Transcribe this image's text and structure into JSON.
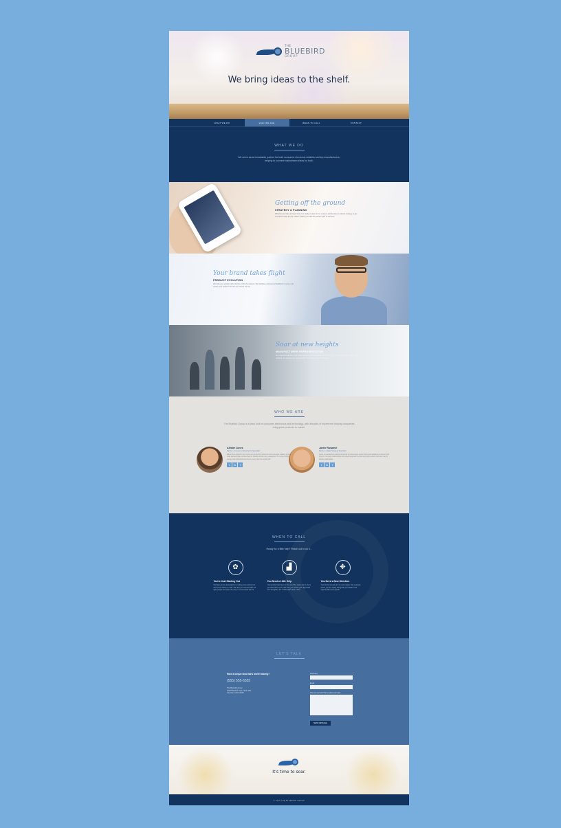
{
  "brand": {
    "the": "THE",
    "name": "BLUEBIRD",
    "group": "GROUP"
  },
  "hero": {
    "headline": "We bring ideas to the shelf."
  },
  "nav": {
    "items": [
      "WHAT WE DO",
      "WHO WE ARE",
      "WHEN TO CALL",
      "CONTACT"
    ],
    "active_index": 1
  },
  "what_we_do": {
    "title": "WHAT WE DO",
    "body": "We serve as an invaluable partner for both consumer electronic retailers and top manufacturers, helping to connect mainstream ideas for both."
  },
  "features": [
    {
      "script": "Getting off the ground",
      "subtitle": "STRATEGY & PLANNING",
      "body": "Whether your idea is brand new or is ready to take off, we analyze and develop a tailored strategy to get a product ready for the market, helping you find the perfect path to success."
    },
    {
      "script": "Your brand takes flight",
      "subtitle": "PRODUCT EVOLUTION",
      "body": "We help your product shine before it hits the shelves. We facilitate professional feedback to refine and evolve your product into the very best it can be."
    },
    {
      "script": "Soar at new heights",
      "subtitle": "MANUFACTURER REPRESENTATION",
      "body": "Our experienced team puts trade strategy and connections to work for you, developing relationships with retailers and shaping the opportunities that drive your brand forward."
    }
  ],
  "who_we_are": {
    "title": "WHO WE ARE",
    "intro": "The Bluebird Group is a team built of consumer electronics and technology, with decades of experience helping companies bring great products to market.",
    "people": [
      {
        "name": "Allister Jones",
        "role": "Partner • Consumer Electronics Specialist",
        "bio": "Allister has worked in the consumer electronics space for over a decade, leading product strategy, retail partnerships and launches for brands across many categories. He brings insight, creative energy and practical know-how to every client he works with."
      },
      {
        "name": "Javier Rosamel",
        "role": "Partner • Retail Strategy Specialist",
        "bio": "Javier is a seasoned retail professional who has spent years helping manufacturers connect with buyers. His deep relationships and careful approach to planning help products find their way to shelves nationwide."
      }
    ],
    "social_icons": [
      "twitter-icon",
      "linkedin-icon",
      "facebook-icon"
    ],
    "social_glyphs": [
      "t",
      "in",
      "f"
    ]
  },
  "when_to_call": {
    "title": "WHEN TO CALL",
    "tagline": "Ready for a little help? Reach out to us if...",
    "columns": [
      {
        "icon": "seedling-icon",
        "glyph": "✿",
        "heading": "You're Just Starting Out",
        "body": "Perhaps you've developed an exciting new product but don't know where to start. We help you connect with the right people and pave the way to a successful launch."
      },
      {
        "icon": "growth-chart-icon",
        "glyph": "▟",
        "heading": "You Need a Little Help",
        "body": "Your product has been on the shelf but sales aren't where you want them to be. We help you rethink your approach and strengthen the relationships that matter."
      },
      {
        "icon": "compass-icon",
        "glyph": "✥",
        "heading": "You Need a New Direction",
        "body": "Your brand is ready for its next chapter. We evaluate where you are today and guide you toward new opportunities and growth."
      }
    ]
  },
  "contact": {
    "title": "LET'S TALK",
    "question": "Have a unique idea that's worth hearing?",
    "phone": "(555) 555-5555",
    "company": "The Bluebird Group",
    "address_line1": "1234 Bluebird Lane, Suite 100",
    "address_line2": "Anytown, USA 12345",
    "form": {
      "name_label": "Full Name",
      "email_label": "Email",
      "message_label": "How can we help? Tell us about your idea.",
      "submit": "SEND MESSAGE"
    }
  },
  "footer": {
    "slogan": "It's time to soar.",
    "copyright": "© 2015 THE BLUEBIRD GROUP"
  }
}
